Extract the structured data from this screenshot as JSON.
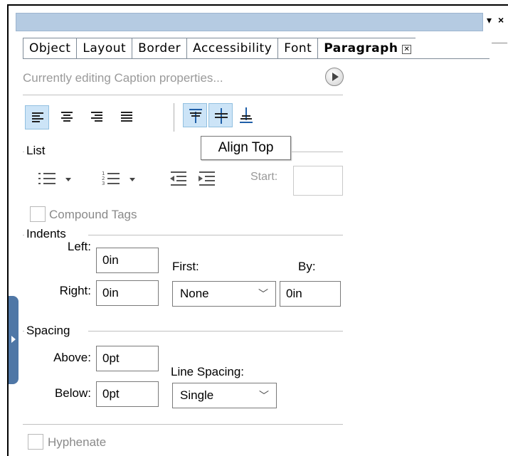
{
  "window": {
    "dropdown_glyph": "▾",
    "close_glyph": "×"
  },
  "tabs": [
    {
      "label": "Object"
    },
    {
      "label": "Layout"
    },
    {
      "label": "Border"
    },
    {
      "label": "Accessibility"
    },
    {
      "label": "Font"
    },
    {
      "label": "Paragraph",
      "active": true
    }
  ],
  "tab_close_glyph": "✕",
  "status_text": "Currently editing Caption properties...",
  "toolbar": {
    "align_buttons": [
      "align-left-icon",
      "align-center-icon",
      "align-right-icon",
      "justify-icon"
    ],
    "valign_buttons": [
      "align-top-icon",
      "align-middle-icon",
      "align-bottom-icon"
    ]
  },
  "tooltip": "Align Top",
  "list": {
    "group_label": "List",
    "start_label": "Start:",
    "start_value": ""
  },
  "compound_tags_label": "Compound Tags",
  "indents": {
    "group_label": "Indents",
    "left_label": "Left:",
    "left_value": "0in",
    "right_label": "Right:",
    "right_value": "0in",
    "first_label": "First:",
    "first_value": "None",
    "by_label": "By:",
    "by_value": "0in"
  },
  "spacing": {
    "group_label": "Spacing",
    "above_label": "Above:",
    "above_value": "0pt",
    "below_label": "Below:",
    "below_value": "0pt",
    "line_spacing_label": "Line Spacing:",
    "line_spacing_value": "Single"
  },
  "hyphenate_label": "Hyphenate",
  "colors": {
    "selected_bg": "#cce4f7",
    "icon_blue": "#1f5fa8",
    "titlebar": "#b5cbe2",
    "side_tab": "#4f77a6"
  }
}
